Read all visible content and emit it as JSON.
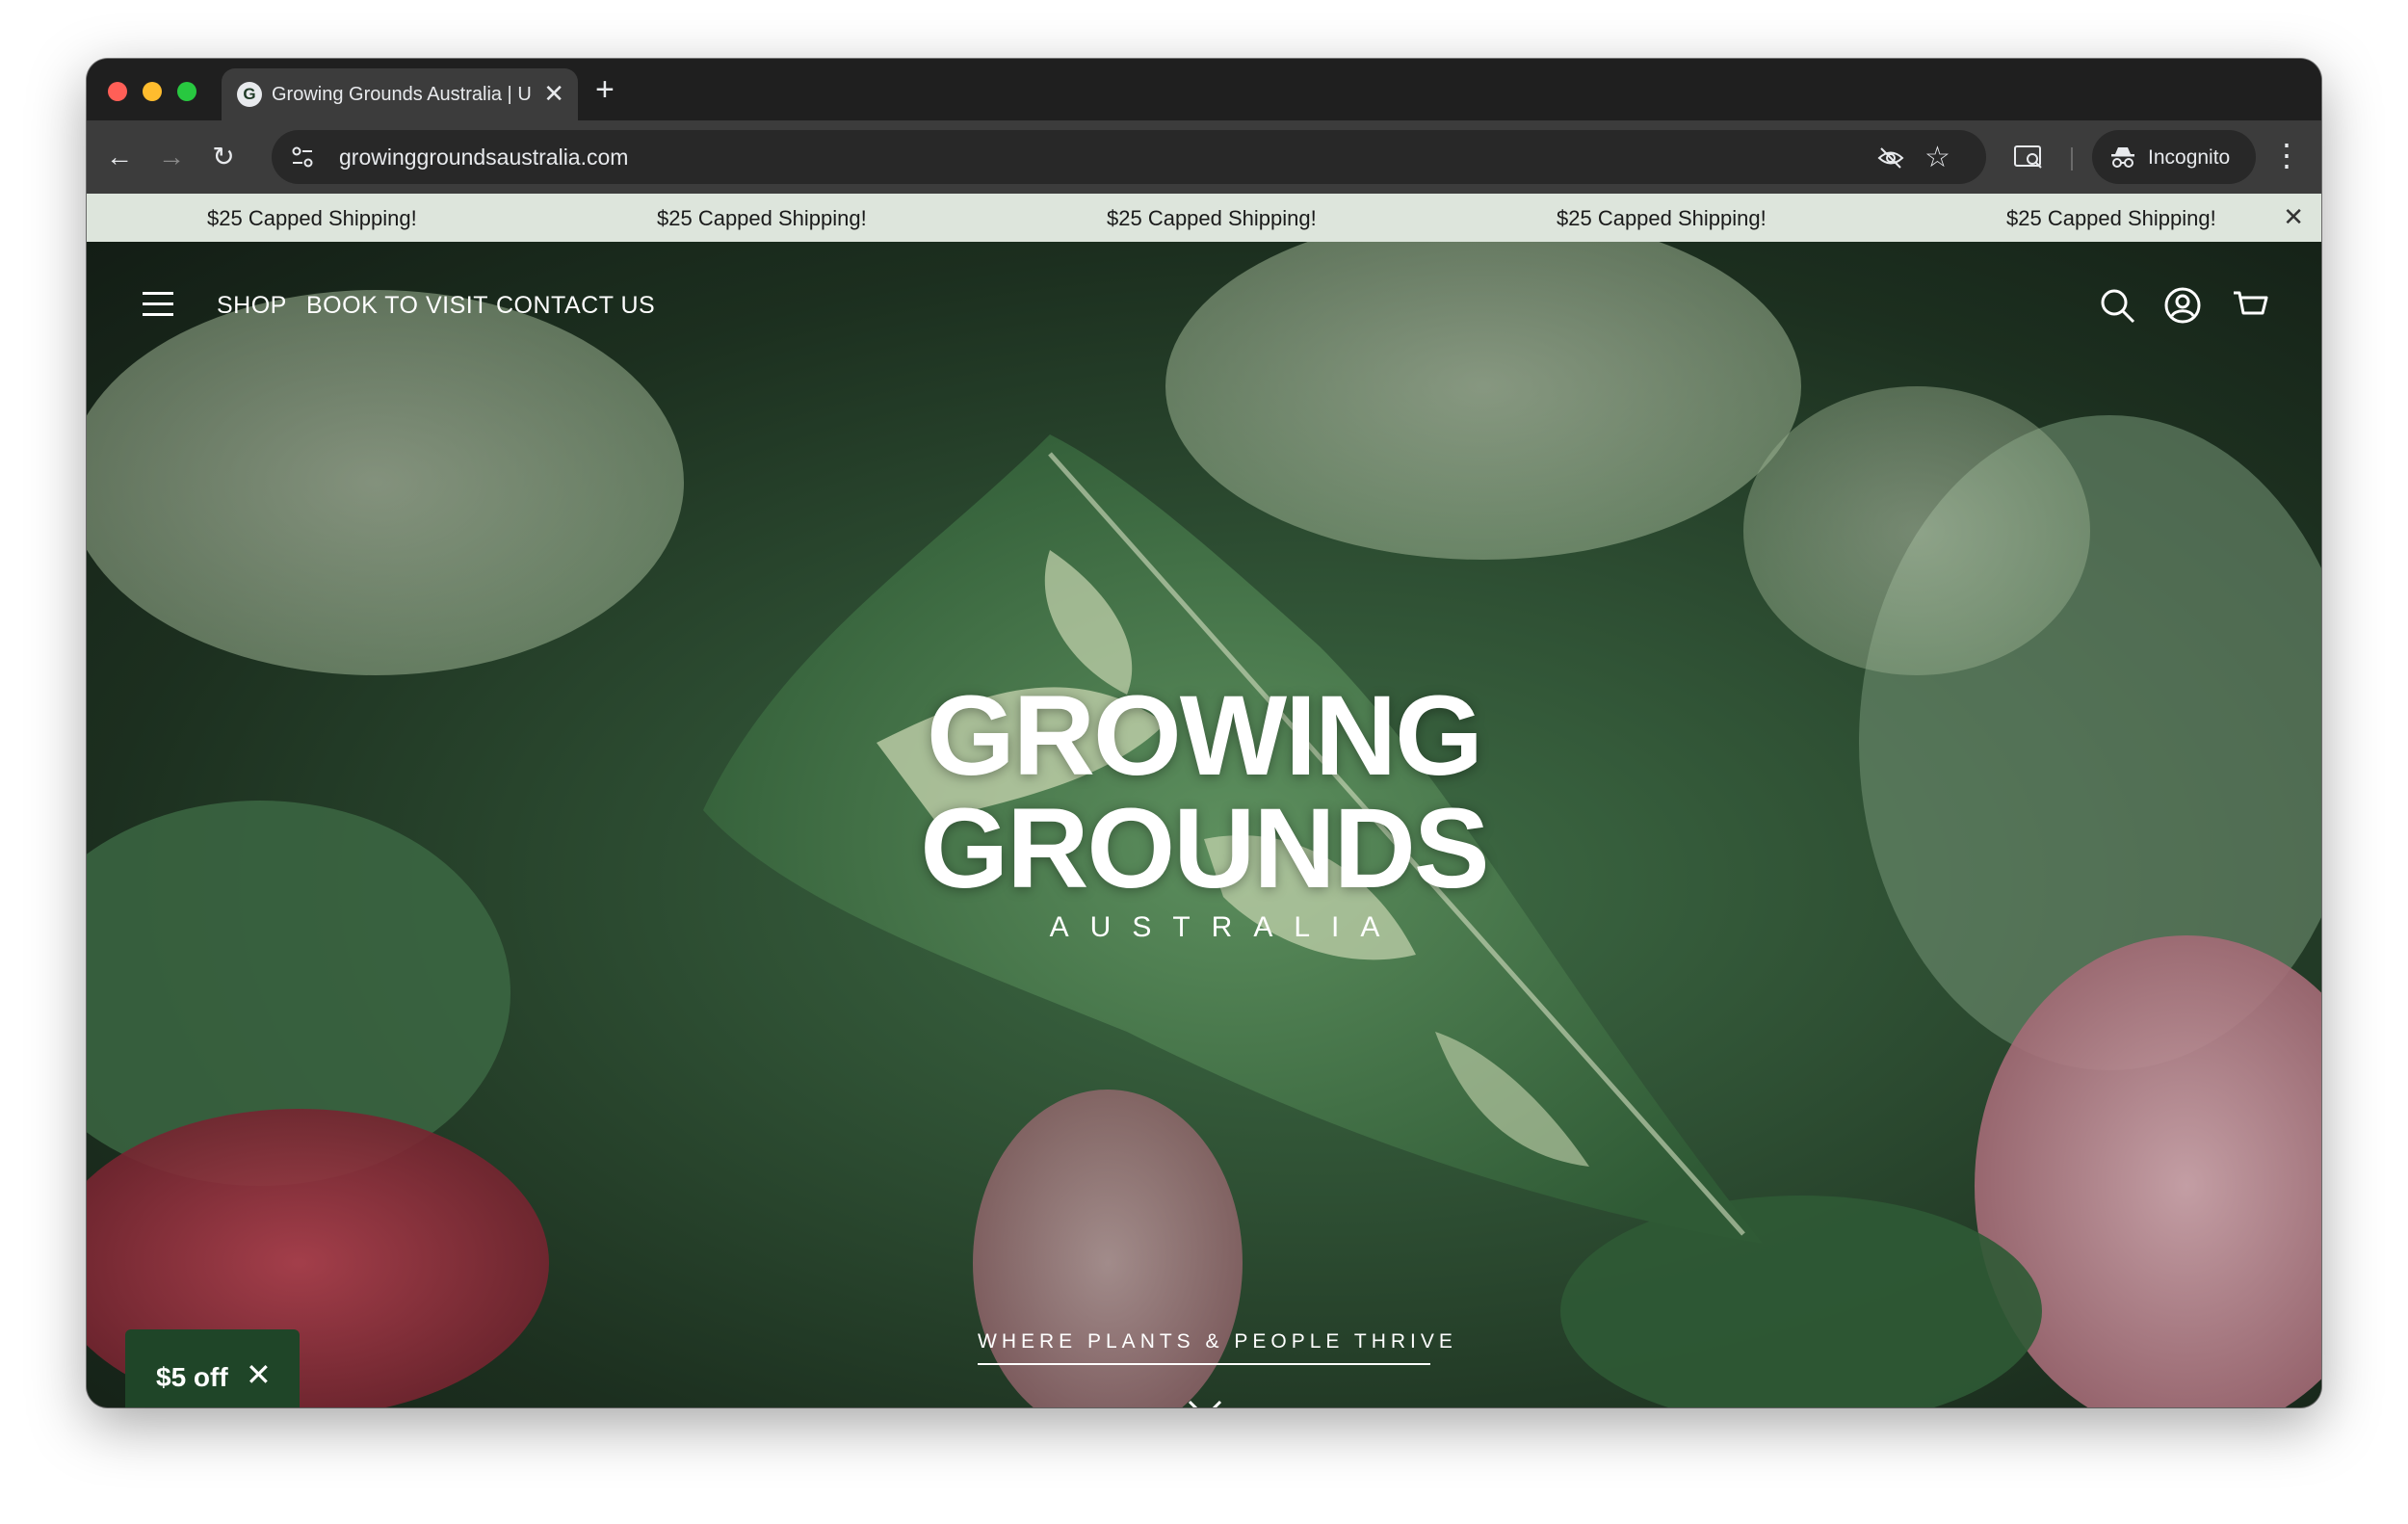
{
  "browser": {
    "tab_title": "Growing Grounds Australia | Unique Plants",
    "tab_favicon_letter": "G",
    "tab_close": "✕",
    "new_tab": "+",
    "url": "growinggroundsaustralia.com",
    "incognito_label": "Incognito",
    "menu": "⋮"
  },
  "announcement": {
    "items": [
      "$25 Capped Shipping!",
      "$25 Capped Shipping!",
      "$25 Capped Shipping!",
      "$25 Capped Shipping!",
      "$25 Capped Shipping!"
    ],
    "close": "✕"
  },
  "nav": {
    "links": [
      "SHOP",
      "BOOK TO VISIT",
      "CONTACT US"
    ]
  },
  "hero": {
    "brand_line_1": "GROWING",
    "brand_line_2": "GROUNDS",
    "brand_sub": "AUSTRALIA",
    "tagline": "WHERE PLANTS & PEOPLE THRIVE"
  },
  "promo": {
    "label": "$5 off",
    "close": "✕"
  },
  "colors": {
    "announcement_bg": "#dde5dc",
    "promo_bg": "#1f4528",
    "hero_text": "#ffffff"
  },
  "icons": [
    "hamburger-icon",
    "search-icon",
    "account-icon",
    "cart-icon",
    "chevron-down-icon"
  ]
}
